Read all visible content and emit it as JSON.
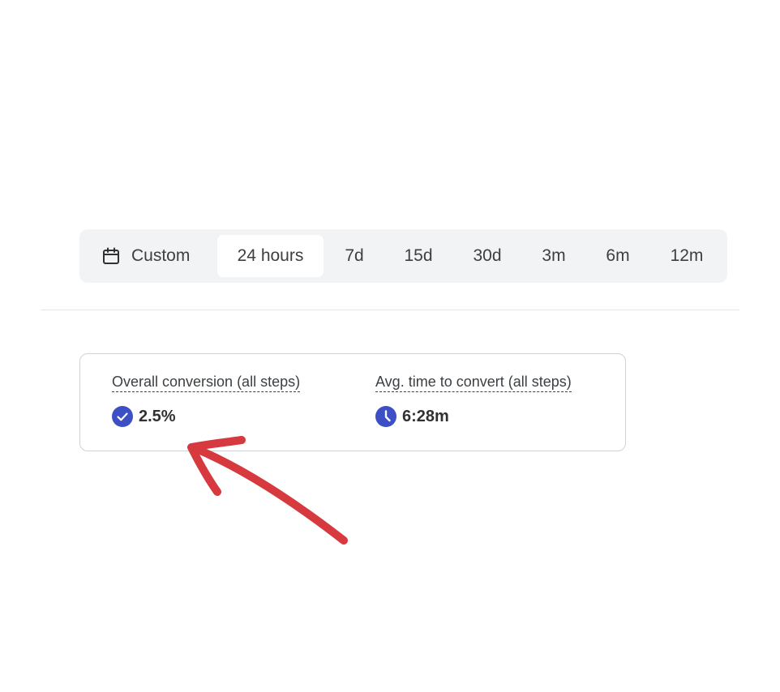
{
  "range_bar": {
    "custom_label": "Custom",
    "items": [
      {
        "label": "24 hours",
        "selected": true
      },
      {
        "label": "7d",
        "selected": false
      },
      {
        "label": "15d",
        "selected": false
      },
      {
        "label": "30d",
        "selected": false
      },
      {
        "label": "3m",
        "selected": false
      },
      {
        "label": "6m",
        "selected": false
      },
      {
        "label": "12m",
        "selected": false
      }
    ]
  },
  "stats": {
    "conversion": {
      "label": "Overall conversion (all steps)",
      "value": "2.5%",
      "icon": "check-circle-icon"
    },
    "time_to_convert": {
      "label": "Avg. time to convert (all steps)",
      "value": "6:28m",
      "icon": "clock-icon"
    }
  },
  "colors": {
    "accent": "#3d4fc4",
    "annotation": "#d63a3f",
    "range_bar_bg": "#f1f3f5"
  }
}
